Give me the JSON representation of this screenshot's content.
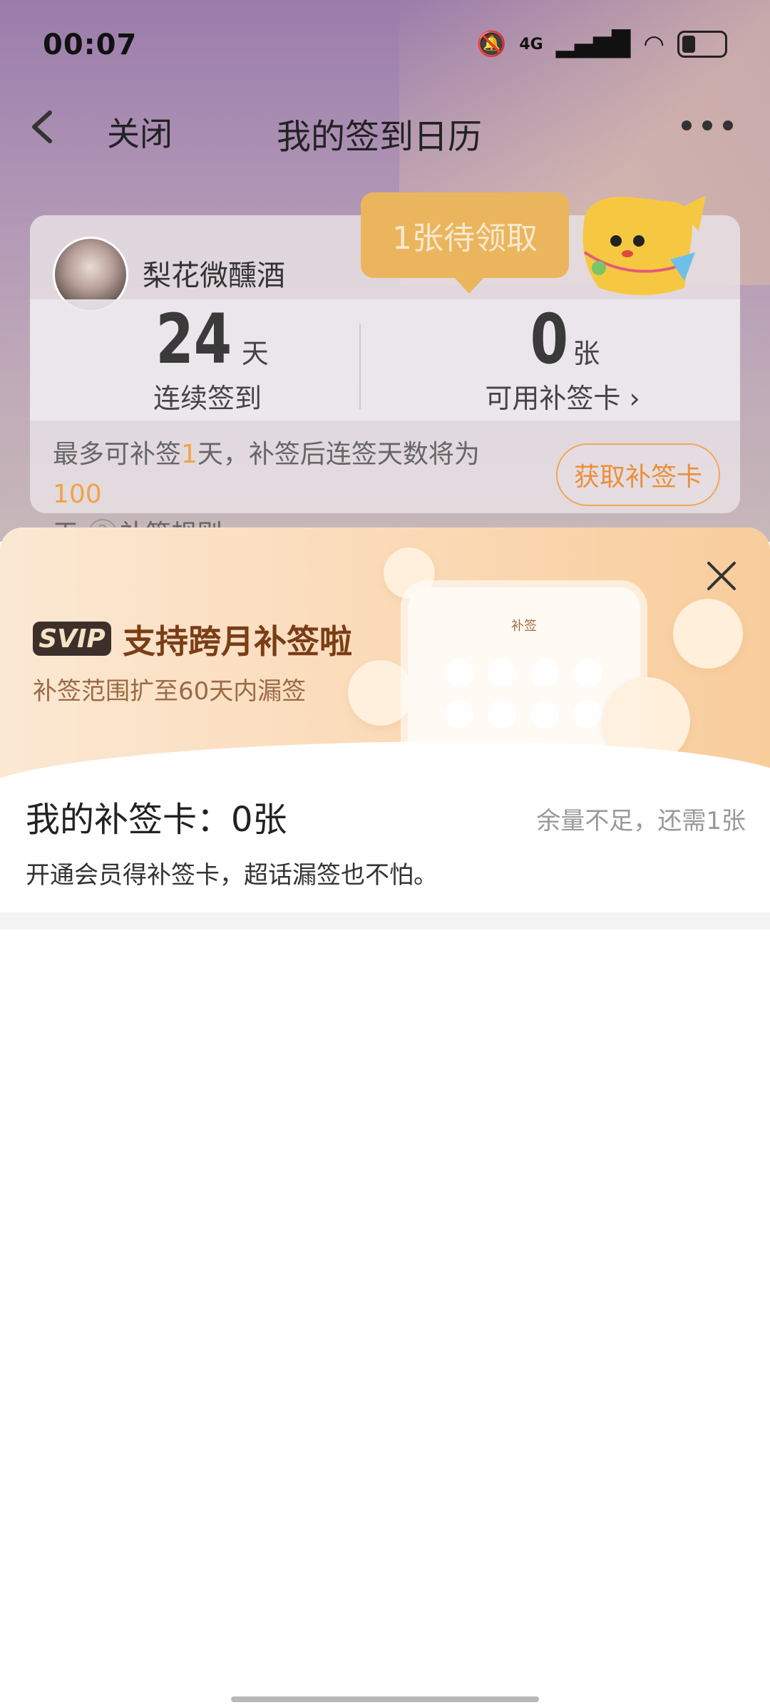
{
  "status": {
    "time": "00:07",
    "network": "4G"
  },
  "nav": {
    "close_label": "关闭",
    "title": "我的签到日历"
  },
  "profile": {
    "username": "梨花微醺酒"
  },
  "tooltip": {
    "text": "1张待领取"
  },
  "stats": {
    "streak_value": "24",
    "streak_unit": "天",
    "streak_label": "连续签到",
    "cards_value": "0",
    "cards_unit": "张",
    "cards_label": "可用补签卡 ›"
  },
  "tip": {
    "prefix": "最多可补签",
    "days": "1",
    "middle": "天，补签后连签天数将为",
    "total": "100",
    "suffix": "天",
    "rules": "补签规则"
  },
  "get_card_button": "获取补签卡",
  "banner": {
    "badge": "SVIP",
    "title": "支持跨月补签啦",
    "subtitle": "补签范围扩至60天内漏签",
    "phone_label": "补签"
  },
  "sheet": {
    "my_cards": "我的补签卡：0张",
    "need_more": "余量不足，还需1张",
    "promo": "开通会员得补签卡，超话漏签也不怕。"
  },
  "colors": {
    "accent": "#f0a347",
    "tooltip": "#ebb55e",
    "svip_badge": "#3d2f2a"
  }
}
